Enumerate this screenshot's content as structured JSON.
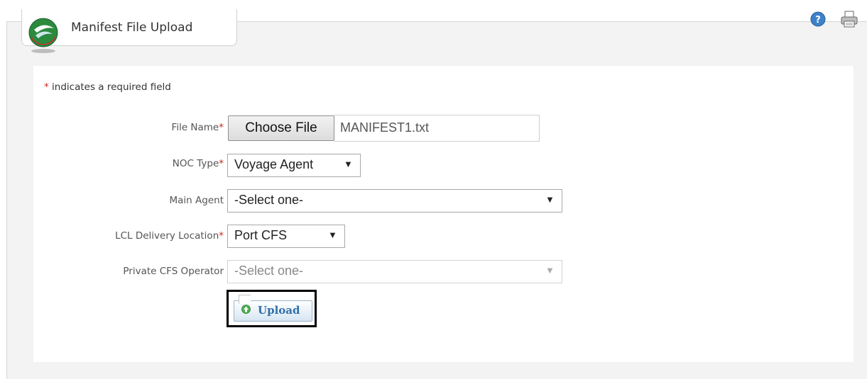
{
  "window": {
    "title": "Manifest File Upload",
    "help_icon": "help-icon",
    "print_icon": "printer-icon"
  },
  "form": {
    "required_note_star": "*",
    "required_note": " indicates a required field",
    "file_name": {
      "label": "File Name",
      "required": "*",
      "button_label": "Choose File",
      "selected_file": "MANIFEST1.txt"
    },
    "noc_type": {
      "label": "NOC Type",
      "required": "*",
      "selected": "Voyage Agent"
    },
    "main_agent": {
      "label": "Main Agent",
      "selected": "-Select one-"
    },
    "lcl_delivery_location": {
      "label": "LCL Delivery Location",
      "required": "*",
      "selected": "Port CFS"
    },
    "private_cfs_operator": {
      "label": "Private CFS Operator",
      "selected": "-Select one-",
      "disabled": true
    },
    "upload_button": {
      "label": "Upload",
      "icon": "upload-arrow-icon"
    }
  },
  "colors": {
    "required_star": "#d0231c",
    "upload_text": "#2f6fa8"
  }
}
